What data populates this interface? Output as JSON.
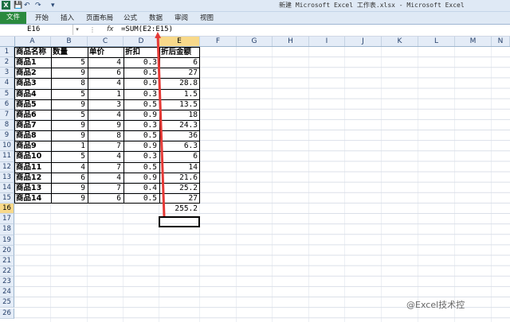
{
  "window": {
    "title": "新建 Microsoft Excel 工作表.xlsx - Microsoft Excel",
    "app_icon": "X",
    "quick_access": [
      "save-icon",
      "undo-icon",
      "redo-icon",
      "customize-icon"
    ]
  },
  "ribbon": {
    "file": "文件",
    "tabs": [
      "开始",
      "插入",
      "页面布局",
      "公式",
      "数据",
      "审阅",
      "视图"
    ]
  },
  "formula_bar": {
    "name_box": "E16",
    "fx": "fx",
    "formula": "=SUM(E2:E15)"
  },
  "columns": [
    "A",
    "B",
    "C",
    "D",
    "E",
    "F",
    "G",
    "H",
    "I",
    "J",
    "K",
    "L",
    "M",
    "N"
  ],
  "active_column": "E",
  "rows": [
    "1",
    "2",
    "3",
    "4",
    "5",
    "6",
    "7",
    "8",
    "9",
    "10",
    "11",
    "12",
    "13",
    "14",
    "15",
    "16",
    "17",
    "18",
    "19",
    "20",
    "21",
    "22",
    "23",
    "24",
    "25",
    "26"
  ],
  "active_row": "16",
  "table": {
    "headers": [
      "商品名称",
      "数量",
      "单价",
      "折扣",
      "折后金额"
    ],
    "rows": [
      [
        "商品1",
        "5",
        "4",
        "0.3",
        "6"
      ],
      [
        "商品2",
        "9",
        "6",
        "0.5",
        "27"
      ],
      [
        "商品3",
        "8",
        "4",
        "0.9",
        "28.8"
      ],
      [
        "商品4",
        "5",
        "1",
        "0.3",
        "1.5"
      ],
      [
        "商品5",
        "9",
        "3",
        "0.5",
        "13.5"
      ],
      [
        "商品6",
        "5",
        "4",
        "0.9",
        "18"
      ],
      [
        "商品7",
        "9",
        "9",
        "0.3",
        "24.3"
      ],
      [
        "商品8",
        "9",
        "8",
        "0.5",
        "36"
      ],
      [
        "商品9",
        "1",
        "7",
        "0.9",
        "6.3"
      ],
      [
        "商品10",
        "5",
        "4",
        "0.3",
        "6"
      ],
      [
        "商品11",
        "4",
        "7",
        "0.5",
        "14"
      ],
      [
        "商品12",
        "6",
        "4",
        "0.9",
        "21.6"
      ],
      [
        "商品13",
        "9",
        "7",
        "0.4",
        "25.2"
      ],
      [
        "商品14",
        "9",
        "6",
        "0.5",
        "27"
      ]
    ],
    "total": "255.2"
  },
  "annotation_color": "#e53935",
  "watermark": "@Excel技术控"
}
